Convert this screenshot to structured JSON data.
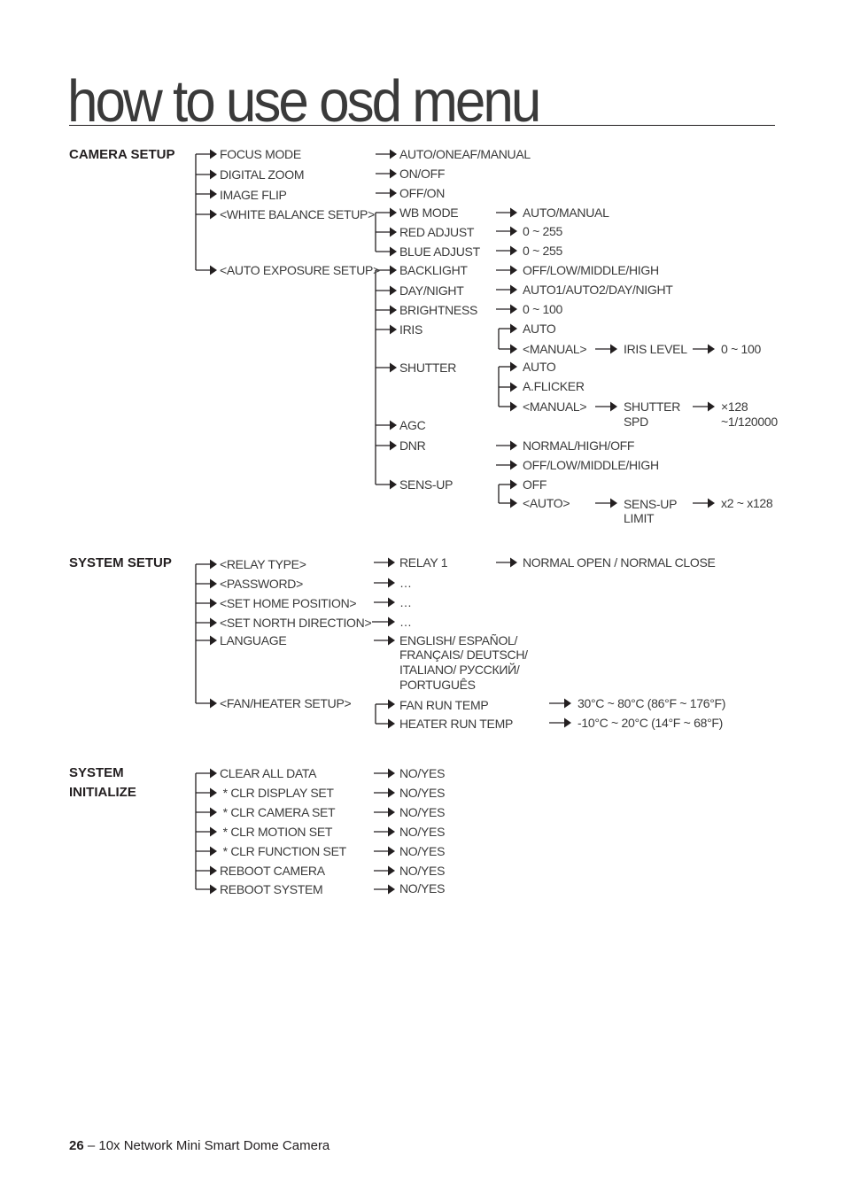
{
  "page": {
    "title": "how to use osd menu",
    "footer": {
      "page_number": "26",
      "separator": " – ",
      "document_title": "10x Network Mini Smart Dome Camera"
    }
  },
  "sections": {
    "camera_setup": {
      "label": "CAMERA SETUP",
      "items": {
        "focus_mode": {
          "label": "FOCUS MODE",
          "value": "AUTO/ONEAF/MANUAL"
        },
        "digital_zoom": {
          "label": "DIGITAL ZOOM",
          "value": "ON/OFF"
        },
        "image_flip": {
          "label": "IMAGE FLIP",
          "value": "OFF/ON"
        },
        "white_balance": {
          "label": "<WHITE BALANCE SETUP>",
          "wb_mode": {
            "label": "WB MODE",
            "value": "AUTO/MANUAL"
          },
          "red_adjust": {
            "label": "RED ADJUST",
            "value": "0 ~ 255"
          },
          "blue_adjust": {
            "label": "BLUE ADJUST",
            "value": "0 ~ 255"
          }
        },
        "auto_exposure": {
          "label": "<AUTO EXPOSURE SETUP>",
          "backlight": {
            "label": "BACKLIGHT",
            "value": "OFF/LOW/MIDDLE/HIGH"
          },
          "day_night": {
            "label": "DAY/NIGHT",
            "value": "AUTO1/AUTO2/DAY/NIGHT"
          },
          "brightness": {
            "label": "BRIGHTNESS",
            "value": "0 ~ 100"
          },
          "iris": {
            "label": "IRIS",
            "auto": "AUTO",
            "manual": "<MANUAL>",
            "iris_level": "IRIS LEVEL",
            "iris_level_value": "0 ~ 100"
          },
          "shutter": {
            "label": "SHUTTER",
            "auto": "AUTO",
            "aflicker": "A.FLICKER",
            "manual": "<MANUAL>",
            "shutter_spd_line1": "SHUTTER",
            "shutter_spd_line2": "SPD",
            "shutter_spd_value_line1": "×128",
            "shutter_spd_value_line2": "~1/120000"
          },
          "agc": {
            "label": "AGC"
          },
          "dnr": {
            "label": "DNR",
            "value1": "NORMAL/HIGH/OFF",
            "value2": "OFF/LOW/MIDDLE/HIGH"
          },
          "sens_up": {
            "label": "SENS-UP",
            "off": "OFF",
            "auto": "<AUTO>",
            "limit_line1": "SENS-UP",
            "limit_line2": "LIMIT",
            "limit_value": "x2 ~ x128"
          }
        }
      }
    },
    "system_setup": {
      "label": "SYSTEM SETUP",
      "items": {
        "relay_type": {
          "label": "<RELAY TYPE>",
          "sub": "RELAY 1",
          "value": "NORMAL OPEN / NORMAL CLOSE"
        },
        "password": {
          "label": "<PASSWORD>",
          "value": "…"
        },
        "home_position": {
          "label": "<SET HOME POSITION>",
          "value": "…"
        },
        "north_direction": {
          "label": "<SET NORTH DIRECTION>",
          "value": "…"
        },
        "language": {
          "label": "LANGUAGE",
          "values": [
            "ENGLISH/ ESPAÑOL/",
            "FRANÇAIS/ DEUTSCH/",
            "ITALIANO/ РУССКИЙ/",
            "PORTUGUÊS"
          ]
        },
        "fan_heater": {
          "label": "<FAN/HEATER SETUP>",
          "fan": {
            "label": "FAN RUN TEMP",
            "value": "30°C ~ 80°C (86°F ~ 176°F)"
          },
          "heater": {
            "label": "HEATER RUN TEMP",
            "value": "-10°C ~ 20°C (14°F ~ 68°F)"
          }
        }
      }
    },
    "system_initialize": {
      "label_line1": "SYSTEM",
      "label_line2": "INITIALIZE",
      "items": [
        {
          "label": "CLEAR ALL DATA",
          "value": "NO/YES"
        },
        {
          "label": " * CLR DISPLAY SET",
          "value": "NO/YES"
        },
        {
          "label": " * CLR CAMERA SET",
          "value": "NO/YES"
        },
        {
          "label": " * CLR MOTION SET",
          "value": "NO/YES"
        },
        {
          "label": " * CLR FUNCTION SET",
          "value": "NO/YES"
        },
        {
          "label": "REBOOT CAMERA",
          "value": "NO/YES"
        },
        {
          "label": "REBOOT SYSTEM",
          "value": "NO/YES"
        }
      ]
    }
  }
}
